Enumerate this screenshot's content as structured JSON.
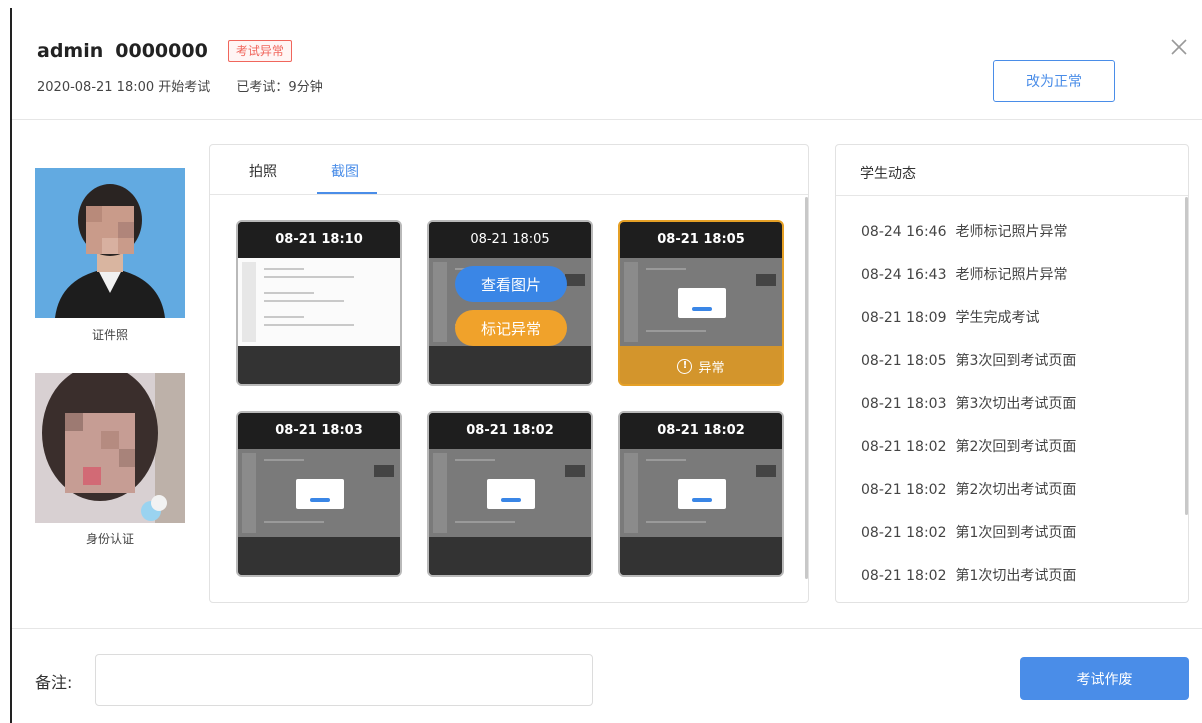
{
  "header": {
    "name": "admin",
    "id": "0000000",
    "status_badge": "考试异常",
    "start_info": "2020-08-21 18:00 开始考试",
    "elapsed": "已考试：9分钟",
    "mark_normal_button": "改为正常"
  },
  "photos": {
    "id_photo_caption": "证件照",
    "face_photo_caption": "身份认证"
  },
  "tabs": [
    {
      "label": "拍照",
      "active": false
    },
    {
      "label": "截图",
      "active": true
    }
  ],
  "screenshots": [
    {
      "time": "08-21 18:10"
    },
    {
      "time": "08-21 18:05",
      "view_button": "查看图片",
      "mark_button": "标记异常"
    },
    {
      "time": "08-21 18:05",
      "abnormal_label": "异常"
    },
    {
      "time": "08-21 18:03"
    },
    {
      "time": "08-21 18:02"
    },
    {
      "time": "08-21 18:02"
    }
  ],
  "activity": {
    "title": "学生动态",
    "events": [
      {
        "time": "08-24 16:46",
        "text": "老师标记照片异常"
      },
      {
        "time": "08-24 16:43",
        "text": "老师标记照片异常"
      },
      {
        "time": "08-21 18:09",
        "text": "学生完成考试"
      },
      {
        "time": "08-21 18:05",
        "text": "第3次回到考试页面"
      },
      {
        "time": "08-21 18:03",
        "text": "第3次切出考试页面"
      },
      {
        "time": "08-21 18:02",
        "text": "第2次回到考试页面"
      },
      {
        "time": "08-21 18:02",
        "text": "第2次切出考试页面"
      },
      {
        "time": "08-21 18:02",
        "text": "第1次回到考试页面"
      },
      {
        "time": "08-21 18:02",
        "text": "第1次切出考试页面"
      }
    ]
  },
  "footer": {
    "note_label": "备注:",
    "note_value": "",
    "void_button": "考试作废"
  },
  "colors": {
    "primary": "#4a8de8",
    "abnormal": "#f0665c",
    "warning": "#d3952c"
  }
}
